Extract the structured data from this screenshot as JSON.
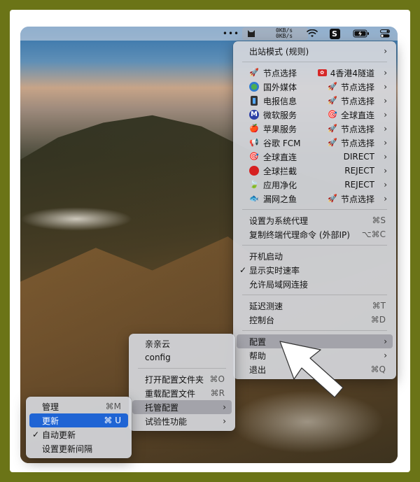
{
  "menubar": {
    "dots": "•••",
    "speed_up": "0KB/s",
    "speed_down": "0KB/s"
  },
  "main_menu": {
    "mode": "出站模式 (规则)",
    "proxies": [
      {
        "name": "节点选择",
        "icon": "rocket-icon",
        "value": "4香港4隧道",
        "value_icon": "hk-flag-icon"
      },
      {
        "name": "国外媒体",
        "icon": "globe-icon",
        "value": "节点选择",
        "value_icon": "rocket-icon"
      },
      {
        "name": "电报信息",
        "icon": "phone-icon",
        "value": "节点选择",
        "value_icon": "rocket-icon"
      },
      {
        "name": "微软服务",
        "icon": "m-icon",
        "value": "全球直连",
        "value_icon": "target-icon"
      },
      {
        "name": "苹果服务",
        "icon": "apple-icon",
        "value": "节点选择",
        "value_icon": "rocket-icon"
      },
      {
        "name": "谷歌 FCM",
        "icon": "speaker-icon",
        "value": "节点选择",
        "value_icon": "rocket-icon"
      },
      {
        "name": "全球直连",
        "icon": "target-icon",
        "value": "DIRECT",
        "value_icon": ""
      },
      {
        "name": "全球拦截",
        "icon": "stop-icon",
        "value": "REJECT",
        "value_icon": ""
      },
      {
        "name": "应用净化",
        "icon": "leaf-icon",
        "value": "REJECT",
        "value_icon": ""
      },
      {
        "name": "漏网之鱼",
        "icon": "fish-icon",
        "value": "节点选择",
        "value_icon": "rocket-icon"
      }
    ],
    "set_system_proxy": "设置为系统代理",
    "set_system_proxy_short": "⌘S",
    "copy_cmd": "复制终端代理命令 (外部IP)",
    "copy_cmd_short": "⌥⌘C",
    "launch_at_login": "开机启动",
    "show_speed": "显示实时速率",
    "show_speed_check": "✓",
    "allow_lan": "允许局域网连接",
    "delay_test": "延迟测速",
    "delay_test_short": "⌘T",
    "dashboard": "控制台",
    "dashboard_short": "⌘D",
    "config": "配置",
    "help": "帮助",
    "quit": "退出",
    "quit_short": "⌘Q"
  },
  "config_menu": {
    "profile1": "亲亲云",
    "profile2": "config",
    "open_folder": "打开配置文件夹",
    "open_folder_short": "⌘O",
    "reload": "重载配置文件",
    "reload_short": "⌘R",
    "managed": "托管配置",
    "experimental": "试验性功能"
  },
  "managed_menu": {
    "manage": "管理",
    "manage_short": "⌘M",
    "update": "更新",
    "update_short": "⌘ U",
    "auto_update": "自动更新",
    "auto_update_check": "✓",
    "set_interval": "设置更新间隔"
  },
  "colors": {
    "background": "#6b7417",
    "highlight": "#1f64d4"
  }
}
